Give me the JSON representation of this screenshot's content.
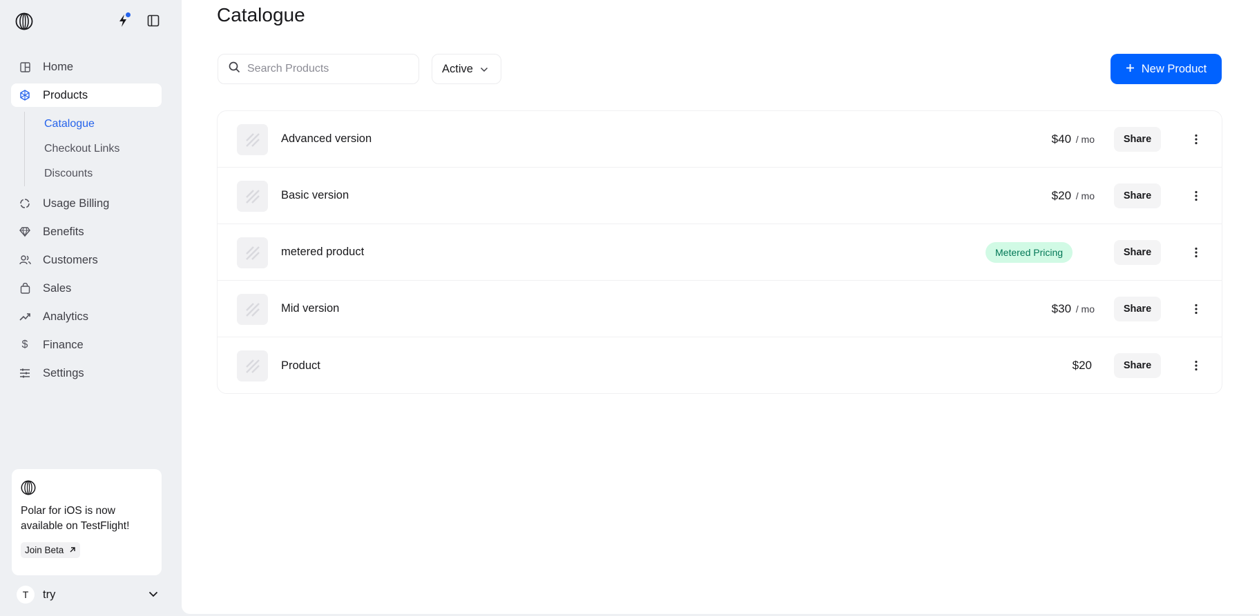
{
  "sidebar": {
    "nav": [
      {
        "label": "Home",
        "icon": "grid-icon"
      },
      {
        "label": "Products",
        "icon": "hexagon-icon",
        "active": true
      },
      {
        "label": "Usage Billing",
        "icon": "circle-dashed-icon"
      },
      {
        "label": "Benefits",
        "icon": "diamond-icon"
      },
      {
        "label": "Customers",
        "icon": "users-icon"
      },
      {
        "label": "Sales",
        "icon": "shopping-bag-icon"
      },
      {
        "label": "Analytics",
        "icon": "trending-up-icon"
      },
      {
        "label": "Finance",
        "icon": "dollar-icon"
      },
      {
        "label": "Settings",
        "icon": "sliders-icon"
      }
    ],
    "subnav": [
      {
        "label": "Catalogue",
        "active": true
      },
      {
        "label": "Checkout Links"
      },
      {
        "label": "Discounts"
      }
    ],
    "promo": {
      "text": "Polar for iOS is now available on TestFlight!",
      "button": "Join Beta"
    },
    "user": {
      "initial": "T",
      "name": "try"
    }
  },
  "main": {
    "title": "Catalogue",
    "search_placeholder": "Search Products",
    "filter": "Active",
    "new_button": "New Product",
    "share_label": "Share",
    "products": [
      {
        "name": "Advanced version",
        "price": "$40",
        "unit": "/ mo"
      },
      {
        "name": "Basic version",
        "price": "$20",
        "unit": "/ mo"
      },
      {
        "name": "metered product",
        "badge": "Metered Pricing"
      },
      {
        "name": "Mid version",
        "price": "$30",
        "unit": "/ mo"
      },
      {
        "name": "Product",
        "price": "$20"
      }
    ]
  },
  "colors": {
    "accent": "#0062ff",
    "active_link": "#2563eb",
    "badge_bg": "#d1fae5",
    "badge_text": "#047857"
  }
}
